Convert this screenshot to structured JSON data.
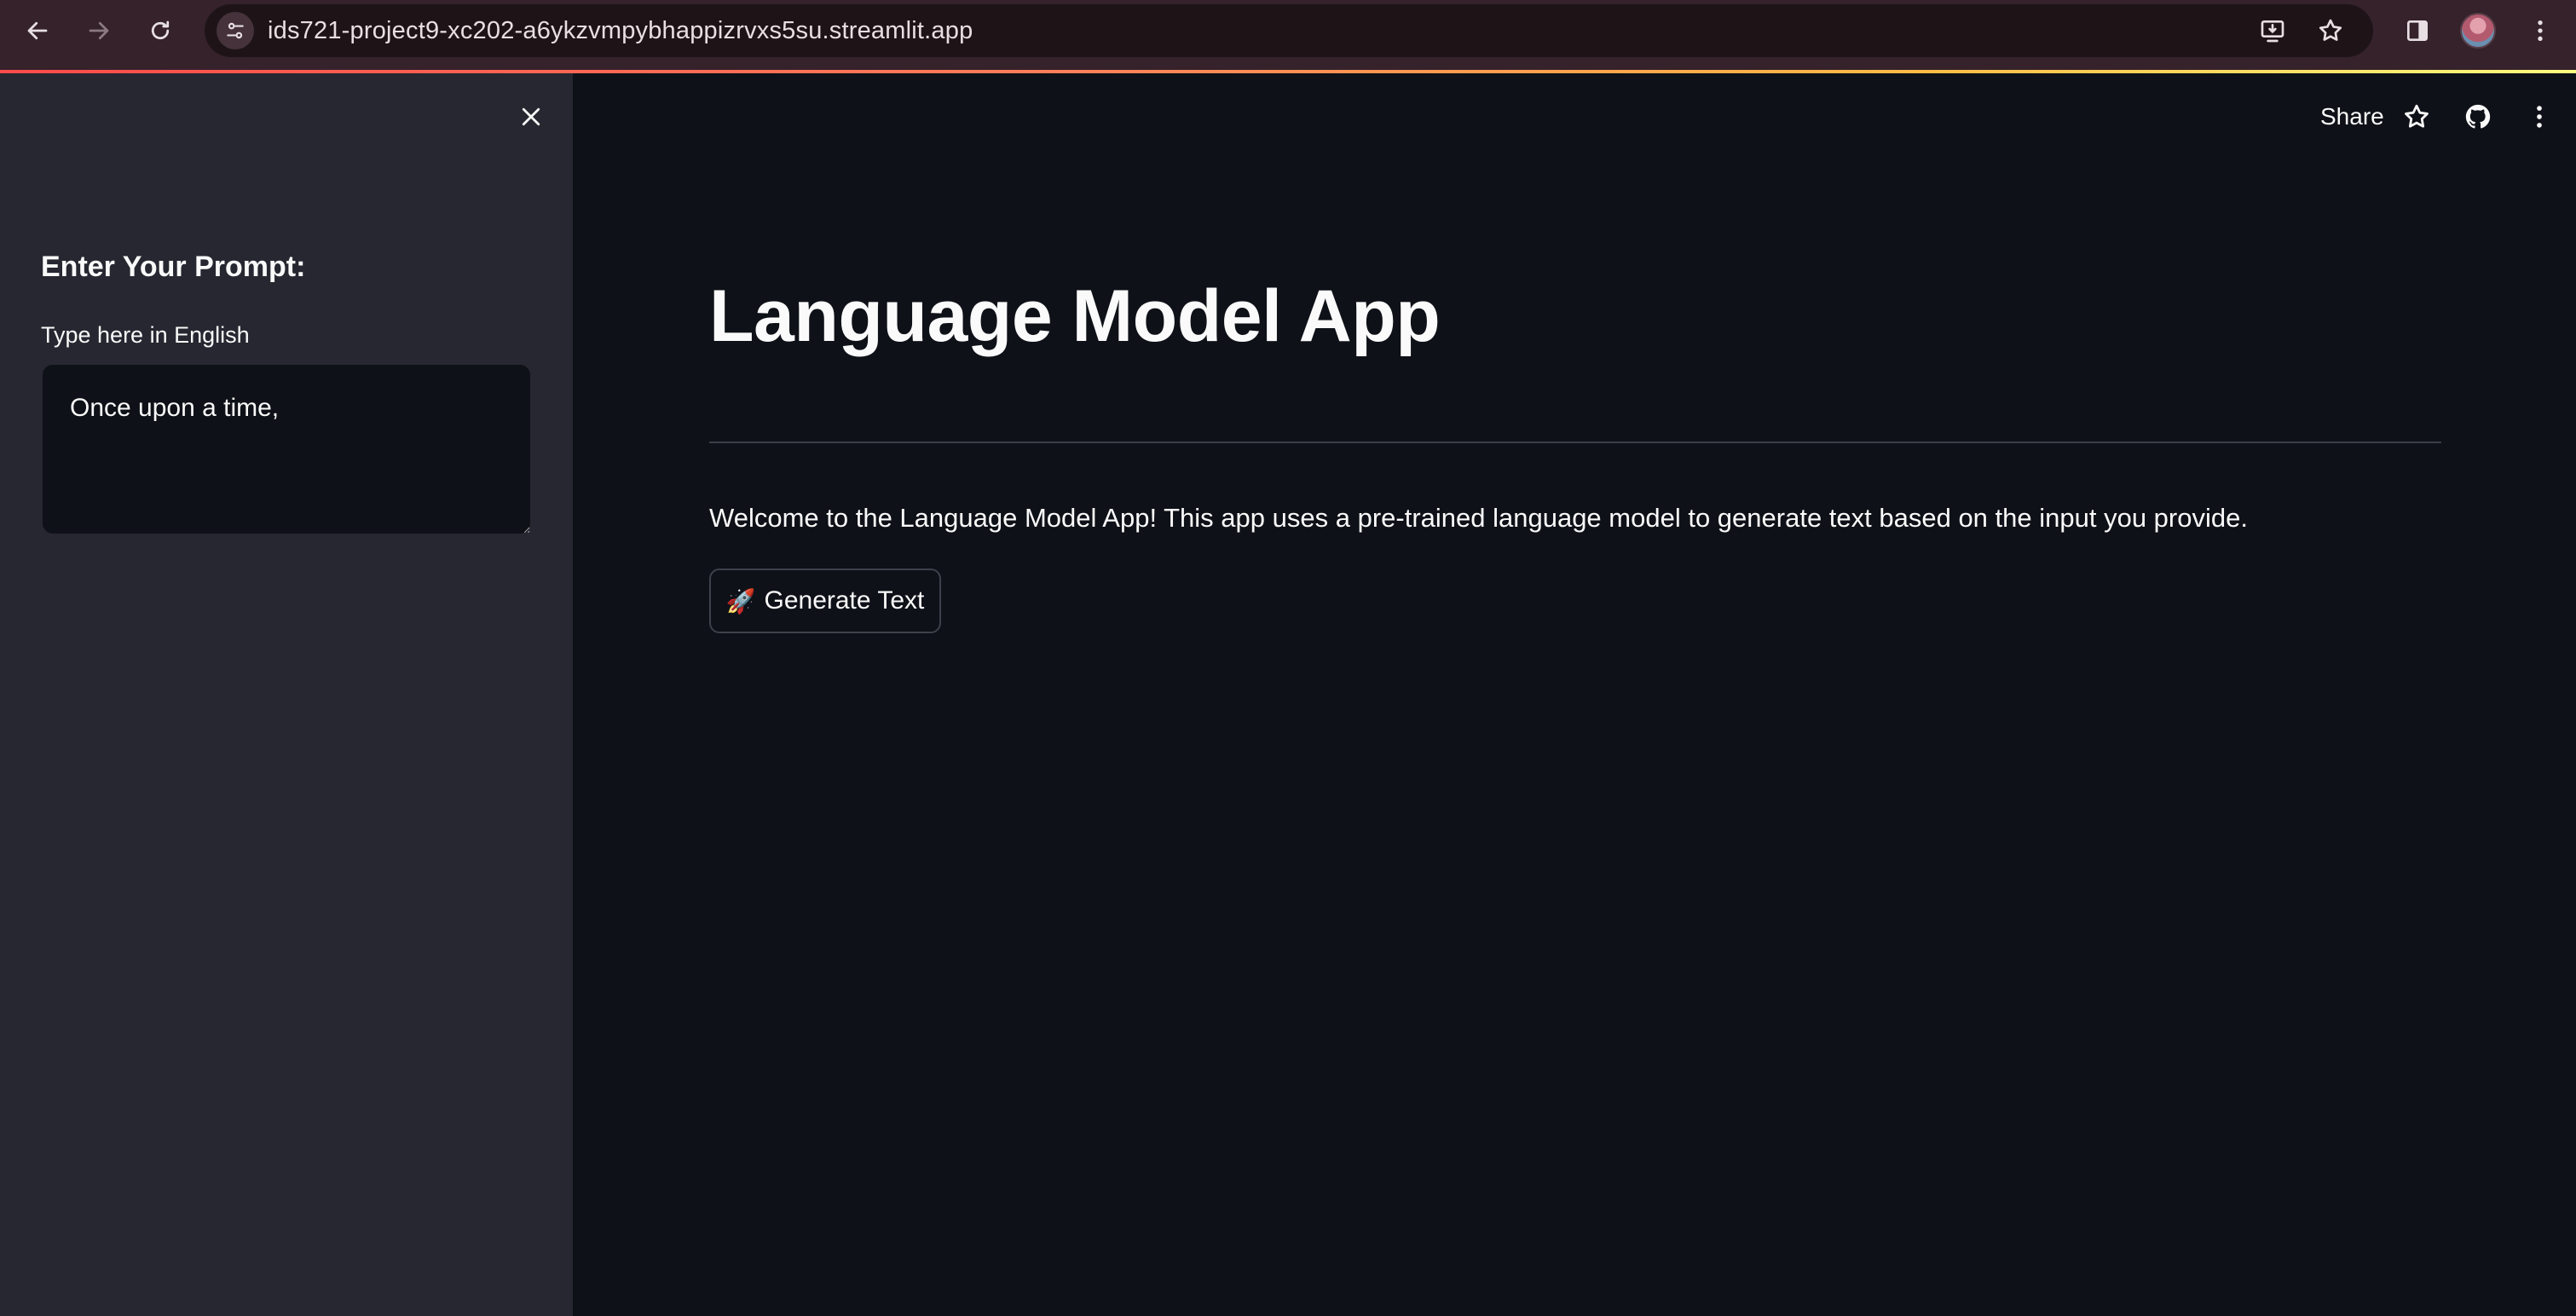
{
  "browser": {
    "url": "ids721-project9-xc202-a6ykzvmpybhappizrvxs5su.streamlit.app",
    "icons": {
      "back": "back-arrow-icon",
      "forward": "forward-arrow-icon",
      "reload": "reload-icon",
      "site_info": "tune-icon",
      "install": "install-app-icon",
      "bookmark": "star-icon",
      "side_panel": "side-panel-icon",
      "profile": "avatar",
      "menu": "kebab-menu-icon"
    }
  },
  "sidebar": {
    "heading": "Enter Your Prompt:",
    "input_label": "Type here in English",
    "input_value": "Once upon a time,",
    "close_icon": "close-icon"
  },
  "main": {
    "toolbar": {
      "share_label": "Share",
      "icons": [
        "star-icon",
        "github-icon",
        "kebab-menu-icon"
      ]
    },
    "title": "Language Model App",
    "description": "Welcome to the Language Model App! This app uses a pre-trained language model to generate text based on the input you provide.",
    "generate_button": {
      "icon": "🚀",
      "label": "Generate Text"
    }
  },
  "colors": {
    "chrome_bg": "#35222b",
    "sidebar_bg": "#262730",
    "main_bg": "#0e1117",
    "text": "#fafafa",
    "accent": "#ff4b4b"
  }
}
